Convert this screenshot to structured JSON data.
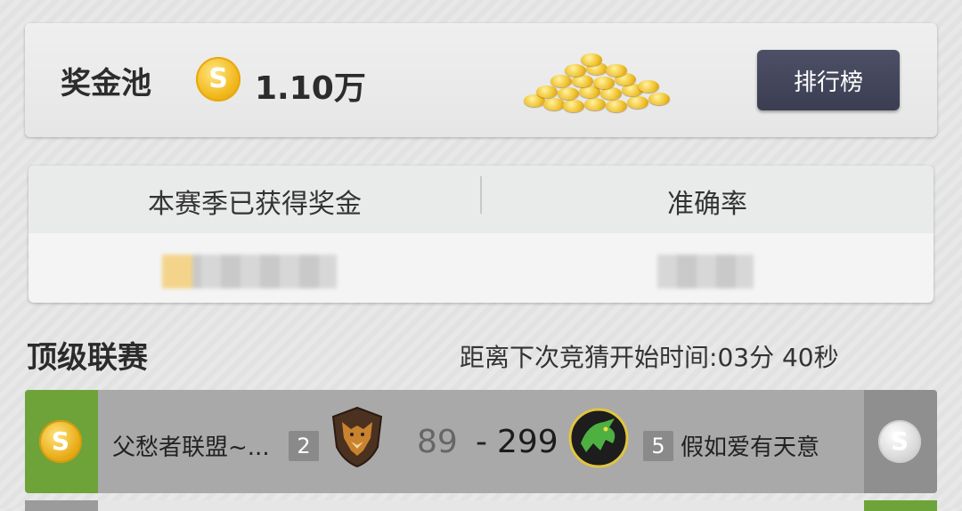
{
  "prize_pool": {
    "title": "奖金池",
    "coin_icon": "gold-coin-icon",
    "value": "1.10万",
    "leaderboard_button": "排行榜"
  },
  "stats": {
    "season_prize_label": "本赛季已获得奖金",
    "accuracy_label": "准确率"
  },
  "league": {
    "title": "顶级联赛",
    "countdown_label": "距离下次竞猜开始时间:",
    "countdown_value": "03分 40秒"
  },
  "match": {
    "home_team": "父愁者联盟~...",
    "home_rank": "2",
    "home_score": "89",
    "separator": "-",
    "away_score": "299",
    "away_rank": "5",
    "away_team": "假如爱有天意",
    "home_logo": "fox-shield-icon",
    "away_logo": "green-dragon-icon",
    "left_coin": "gold-coin-icon",
    "right_coin": "silver-coin-icon",
    "colors": {
      "left_side": "#6ea33a",
      "right_side": "#8f8f8f",
      "row_bg": "#a9a9a9"
    }
  }
}
